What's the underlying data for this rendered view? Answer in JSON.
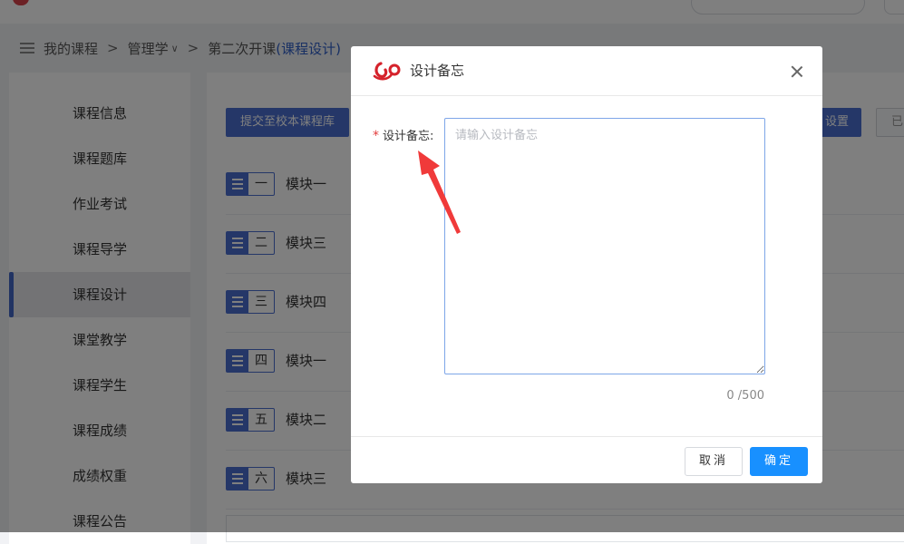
{
  "breadcrumb": {
    "items": [
      "我的课程",
      "管理学",
      "第二次开课"
    ],
    "highlight": "(课程设计)",
    "separator": ">",
    "caret": "∨"
  },
  "sidebar": {
    "items": [
      {
        "label": "课程信息"
      },
      {
        "label": "课程题库"
      },
      {
        "label": "作业考试"
      },
      {
        "label": "课程导学"
      },
      {
        "label": "课程设计",
        "active": true
      },
      {
        "label": "课堂教学"
      },
      {
        "label": "课程学生"
      },
      {
        "label": "课程成绩"
      },
      {
        "label": "成绩权重"
      },
      {
        "label": "课程公告"
      }
    ]
  },
  "toolbar": {
    "submit_label": "提交至校本课程库",
    "settings_label": "设置",
    "ghost_label": "已"
  },
  "modules": [
    {
      "num": "一",
      "name": "模块一"
    },
    {
      "num": "二",
      "name": "模块三"
    },
    {
      "num": "三",
      "name": "模块四"
    },
    {
      "num": "四",
      "name": "模块一"
    },
    {
      "num": "五",
      "name": "模块二"
    },
    {
      "num": "六",
      "name": "模块三"
    }
  ],
  "dialog": {
    "title": "设计备忘",
    "field_required_mark": "*",
    "field_label": "设计备忘:",
    "textarea_value": "",
    "textarea_placeholder": "请输入设计备忘",
    "counter": "0 /500",
    "cancel_label": "取消",
    "ok_label": "确定"
  },
  "colors": {
    "primary": "#4a6fd0",
    "confirm": "#1890ff",
    "required": "#e23c3c",
    "annotation_arrow": "#f03a3a",
    "logo_red": "#d5222b"
  }
}
